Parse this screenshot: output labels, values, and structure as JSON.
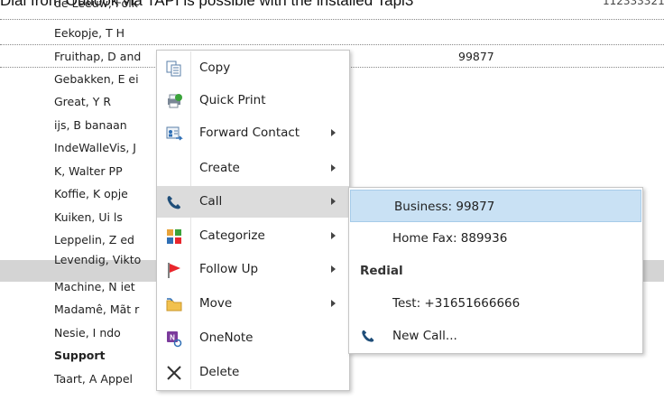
{
  "caption": "Dial from Outlook via TAPI is possible with the installed Tapi3",
  "contacts": [
    {
      "name": "de Leeuw, Folk",
      "phone_right": "112333321"
    },
    {
      "name": "Eekopje, T H",
      "phone": ""
    },
    {
      "name": "Fruithap, D and",
      "phone": "99877"
    },
    {
      "name": "Gebakken, E ei",
      "phone": ""
    },
    {
      "name": "Great, Y R",
      "phone": ""
    },
    {
      "name": "ijs, B banaan",
      "phone": ""
    },
    {
      "name": "IndeWalleVis, J",
      "phone": ""
    },
    {
      "name": "K, Walter PP",
      "phone": ""
    },
    {
      "name": "Koffie, K opje",
      "phone": ""
    },
    {
      "name": "Kuiken, Ui ls",
      "phone": ""
    },
    {
      "name": "Leppelin, Z ed",
      "phone": ""
    },
    {
      "name": "Levendig, Vikto",
      "phone": ""
    },
    {
      "name": "Machine, N iet",
      "phone": ""
    },
    {
      "name": "Madamê, Mãt r",
      "phone": ""
    },
    {
      "name": "Nesie, I ndo",
      "phone": ""
    },
    {
      "name": "Support",
      "phone": ""
    },
    {
      "name": "Taart, A Appel",
      "phone": ""
    }
  ],
  "context_menu": {
    "items": [
      {
        "label": "Copy",
        "icon": "copy-icon"
      },
      {
        "label": "Quick Print",
        "icon": "quick-print-icon"
      },
      {
        "label": "Forward Contact",
        "icon": "forward-contact-icon"
      },
      {
        "label": "Create",
        "icon": ""
      },
      {
        "label": "Call",
        "icon": "phone-icon"
      },
      {
        "label": "Categorize",
        "icon": "categorize-icon"
      },
      {
        "label": "Follow Up",
        "icon": "flag-icon"
      },
      {
        "label": "Move",
        "icon": "folder-icon"
      },
      {
        "label": "OneNote",
        "icon": "onenote-icon"
      },
      {
        "label": "Delete",
        "icon": "delete-icon"
      }
    ]
  },
  "call_submenu": {
    "business": "Business: 99877",
    "home_fax": "Home Fax: 889936",
    "redial_header": "Redial",
    "redial_entry": "Test: +31651666666",
    "new_call": "New Call..."
  },
  "colors": {
    "selected_row": "#d4d4d4",
    "menu_hover": "#dcdcdc",
    "submenu_highlight": "#c9e1f4",
    "flag_red": "#e8262c",
    "phone_blue": "#1f4e79"
  }
}
